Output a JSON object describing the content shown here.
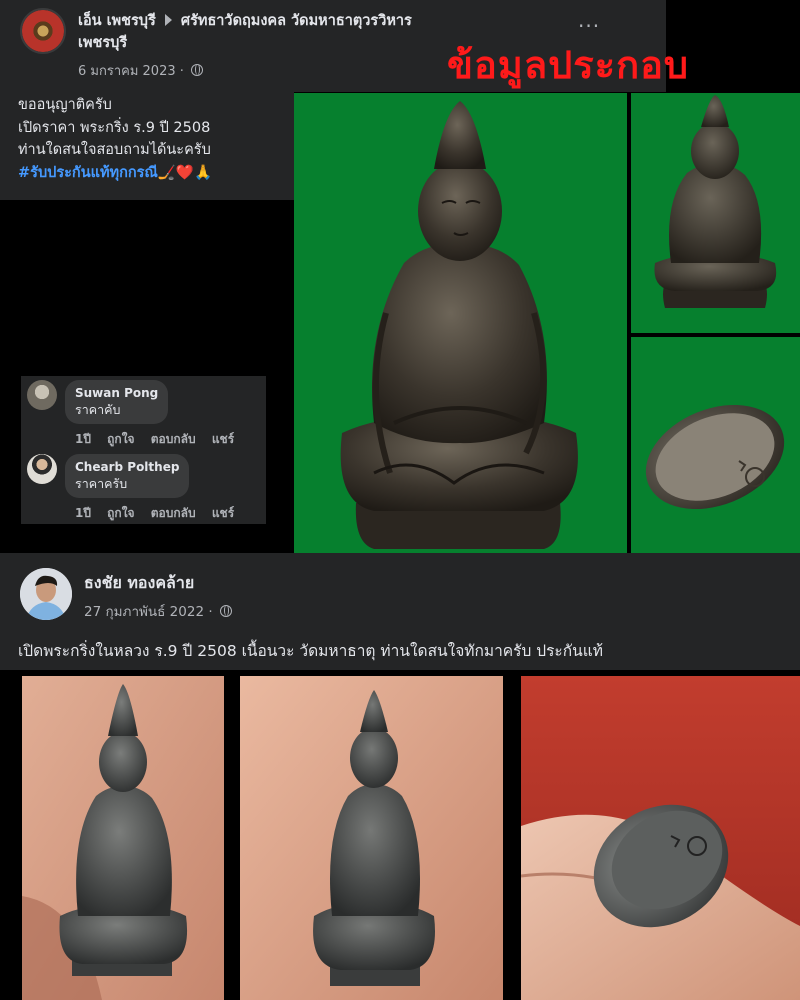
{
  "post1": {
    "author": "เอ็น เพชรบุรี",
    "group": "ศรัทธาวัดฤมงคล วัดมหาธาตุวรวิหาร เพชรบุรี",
    "group_line1": "ศรัทธาวัดฤมงคล วัดมหาธาตุวรวิหาร",
    "group_line2": "เพชรบุรี",
    "date": "6 มกราคม 2023 ·",
    "more_label": "···",
    "lines": [
      "ขออนุญาติครับ",
      "เปิดราคา พระกริ่ง ร.9 ปี 2508",
      "ท่านใดสนใจสอบถามได้นะครับ"
    ],
    "hashtag": "#รับประกันแท้ทุกกรณี",
    "emoji": "🏒❤️🙏",
    "overlay_text": "ข้อมูลประกอบ"
  },
  "comments": [
    {
      "name": "Suwan Pong",
      "text": "ราคาคับ",
      "time": "1ปี",
      "like": "ถูกใจ",
      "reply": "ตอบกลับ",
      "share": "แชร์"
    },
    {
      "name": "Chearb Polthep",
      "text": "ราคาครับ",
      "time": "1ปี",
      "like": "ถูกใจ",
      "reply": "ตอบกลับ",
      "share": "แชร์"
    }
  ],
  "post2": {
    "author": "ธงชัย ทองคล้าย",
    "date": "27 กุมภาพันธ์ 2022 ·",
    "body": "เปิดพระกริ่งในหลวง ร.9 ปี 2508 เนื้อนวะ วัดมหาธาตุ ท่านใดสนใจทักมาครับ ประกันแท้"
  },
  "colors": {
    "card_bg": "#242526",
    "text_primary": "#e4e6eb",
    "text_secondary": "#b0b3b8",
    "hashtag": "#4599ff",
    "overlay_red": "#ff1a1a",
    "photo_green": "#06802e"
  }
}
